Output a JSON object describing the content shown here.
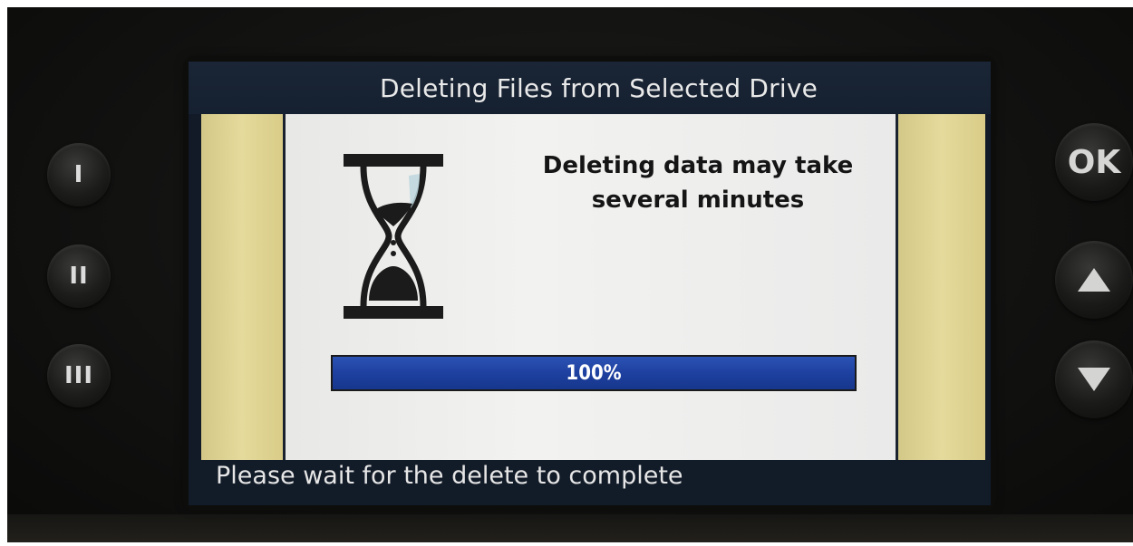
{
  "screen": {
    "title": "Deleting Files from Selected Drive",
    "message_line1": "Deleting data may take",
    "message_line2": "several minutes",
    "progress": {
      "value_percent": 100,
      "label": "100%",
      "fill_color": "#1f43a3"
    },
    "status": "Please wait for the delete to complete",
    "icon": "hourglass-icon"
  },
  "hardware_buttons": {
    "left": [
      {
        "label": "I"
      },
      {
        "label": "II"
      },
      {
        "label": "III"
      }
    ],
    "right": [
      {
        "label": "OK"
      },
      {
        "icon": "arrow-up-icon"
      },
      {
        "icon": "arrow-down-icon"
      }
    ]
  },
  "colors": {
    "side_panel": "#e0d593",
    "screen_bg": "#111a26",
    "content_bg": "#efefed"
  }
}
